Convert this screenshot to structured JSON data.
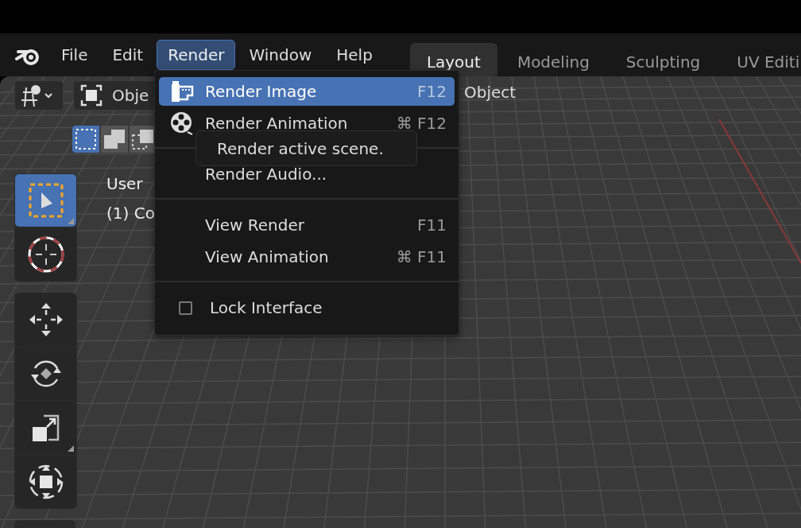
{
  "top_bar": {
    "menus": [
      {
        "label": "File",
        "selected": false
      },
      {
        "label": "Edit",
        "selected": false
      },
      {
        "label": "Render",
        "selected": true
      },
      {
        "label": "Window",
        "selected": false
      },
      {
        "label": "Help",
        "selected": false
      }
    ],
    "workspace_tabs": [
      {
        "label": "Layout",
        "selected": true
      },
      {
        "label": "Modeling",
        "selected": false
      },
      {
        "label": "Sculpting",
        "selected": false
      },
      {
        "label": "UV Editi",
        "selected": false
      }
    ]
  },
  "viewport": {
    "header": {
      "mode_button": "Obje",
      "object_menu": "Object"
    },
    "select_modes": [
      {
        "kind": "new",
        "selected": true
      },
      {
        "kind": "extend",
        "selected": false
      },
      {
        "kind": "subtract",
        "selected": false
      }
    ],
    "overlay_text": [
      "User",
      "(1) Co"
    ],
    "tool_groups": [
      {
        "tools": [
          {
            "kind": "select",
            "selected": true,
            "has_options": true
          },
          {
            "kind": "cursor",
            "selected": false,
            "has_options": false
          }
        ]
      },
      {
        "tools": [
          {
            "kind": "move",
            "selected": false,
            "has_options": false
          },
          {
            "kind": "rotate",
            "selected": false,
            "has_options": false
          },
          {
            "kind": "scale",
            "selected": false,
            "has_options": true
          },
          {
            "kind": "transform",
            "selected": false,
            "has_options": false
          }
        ]
      }
    ]
  },
  "render_menu": {
    "items": [
      {
        "kind": "still",
        "label": "Render Image",
        "shortcut": "F12",
        "selected": true
      },
      {
        "kind": "animation",
        "label": "Render Animation",
        "shortcut": "⌘ F12",
        "selected": false
      },
      {
        "kind": "separator"
      },
      {
        "kind": "item",
        "label": "Render Audio...",
        "selected": false
      },
      {
        "kind": "separator"
      },
      {
        "kind": "item",
        "label": "View Render",
        "shortcut": "F11",
        "selected": false
      },
      {
        "kind": "item",
        "label": "View Animation",
        "shortcut": "⌘ F11",
        "selected": false
      },
      {
        "kind": "separator"
      },
      {
        "kind": "checkbox",
        "label": "Lock Interface",
        "checked": false
      }
    ],
    "tooltip": "Render active scene."
  }
}
